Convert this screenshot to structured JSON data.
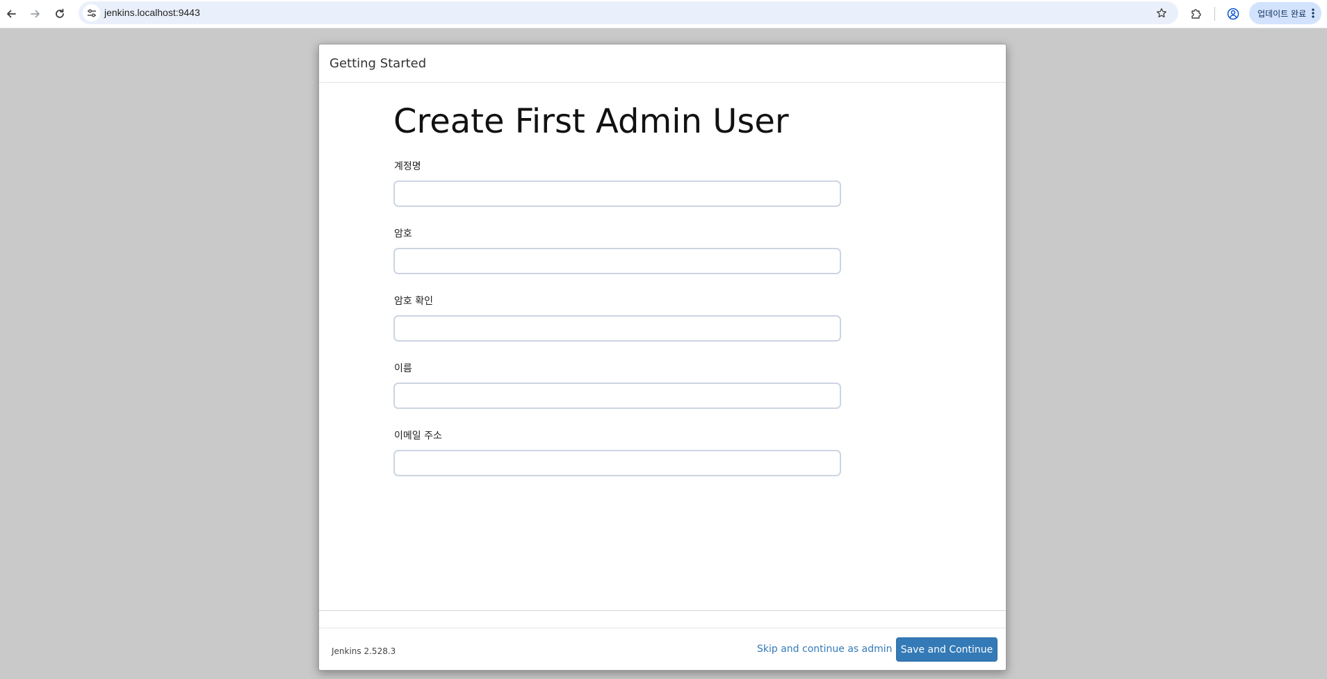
{
  "browser": {
    "url": "jenkins.localhost:9443",
    "update_label": "업데이트 완료"
  },
  "dialog": {
    "header_title": "Getting Started",
    "page_title": "Create First Admin User",
    "fields": [
      {
        "label": "계정명",
        "value": ""
      },
      {
        "label": "암호",
        "value": ""
      },
      {
        "label": "암호 확인",
        "value": ""
      },
      {
        "label": "이름",
        "value": ""
      },
      {
        "label": "이메일 주소",
        "value": ""
      }
    ],
    "footer": {
      "version": "Jenkins 2.528.3",
      "skip_label": "Skip and continue as admin",
      "save_label": "Save and Continue"
    }
  },
  "colors": {
    "page_background": "#c9c9c9",
    "primary_button": "#337ab7",
    "link": "#337ab7",
    "omnibox": "#eaf0fb",
    "update_pill": "#d3e3fd"
  },
  "icons": {
    "back": "arrow-left-icon",
    "forward": "arrow-right-icon",
    "reload": "reload-icon",
    "site_info": "tune-icon",
    "bookmark": "star-icon",
    "extensions": "puzzle-icon",
    "profile": "profile-icon",
    "menu": "more-vert-icon"
  }
}
